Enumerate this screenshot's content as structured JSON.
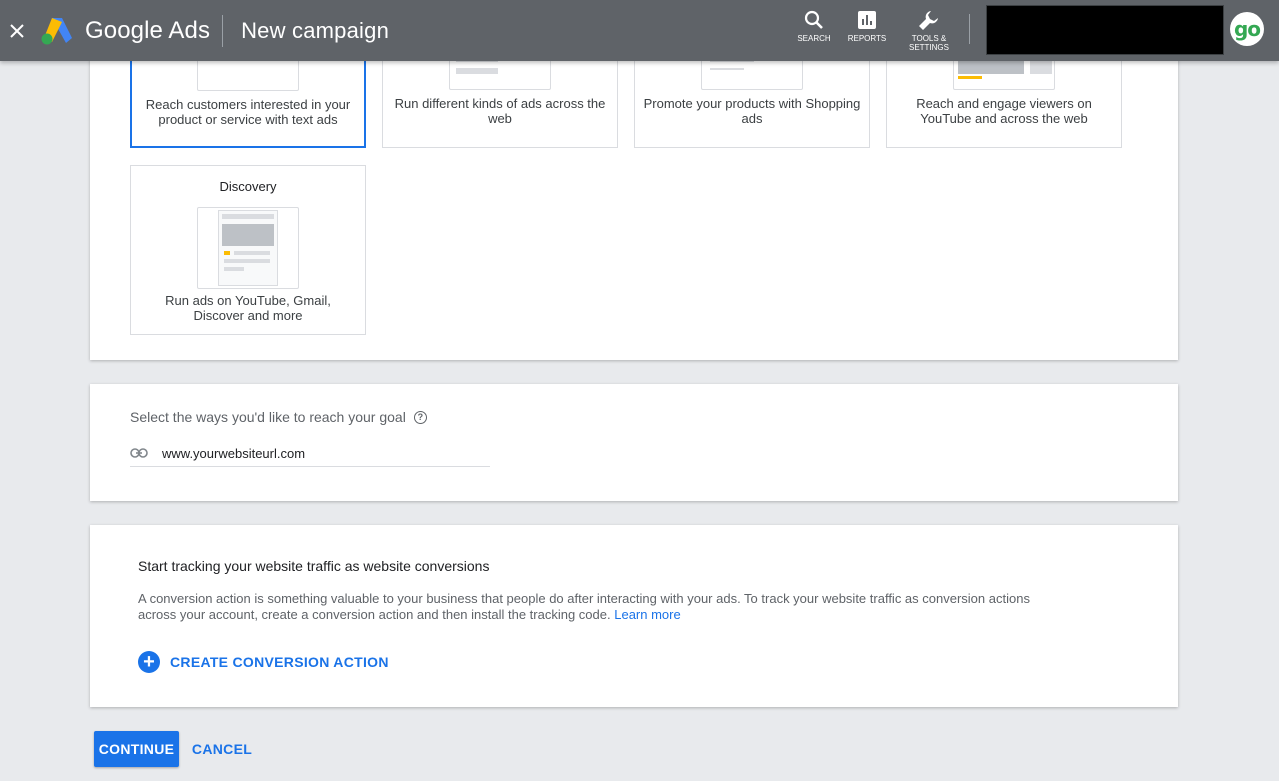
{
  "header": {
    "brand": "Google Ads",
    "title": "New campaign",
    "tools": [
      {
        "label": "SEARCH",
        "icon": "search-icon"
      },
      {
        "label": "REPORTS",
        "icon": "bar-chart-icon"
      },
      {
        "label": "TOOLS & SETTINGS",
        "icon": "wrench-icon"
      }
    ],
    "avatar_text": "go"
  },
  "campaign_types": [
    {
      "title": "",
      "description": "Reach customers interested in your product or service with text ads",
      "selected": true
    },
    {
      "title": "",
      "description": "Run different kinds of ads across the web",
      "selected": false
    },
    {
      "title": "",
      "description": "Promote your products with Shopping ads",
      "selected": false
    },
    {
      "title": "",
      "description": "Reach and engage viewers on YouTube and across the web",
      "selected": false
    },
    {
      "title": "Discovery",
      "description": "Run ads on YouTube, Gmail, Discover and more",
      "selected": false
    }
  ],
  "reach": {
    "label": "Select the ways you'd like to reach your goal",
    "help_icon": "help-icon",
    "link_icon": "link-icon",
    "url_value": "www.yourwebsiteurl.com"
  },
  "tracking": {
    "title": "Start tracking your website traffic as website conversions",
    "body": "A conversion action is something valuable to your business that people do after interacting with your ads. To track your website traffic as conversion actions across your account, create a conversion action and then install the tracking code.",
    "learn_more": "Learn more",
    "create_label": "CREATE CONVERSION ACTION"
  },
  "actions": {
    "continue": "CONTINUE",
    "cancel": "CANCEL"
  },
  "colors": {
    "topbar": "#5f6368",
    "accent": "#1a73e8",
    "background": "#e8eaed"
  }
}
